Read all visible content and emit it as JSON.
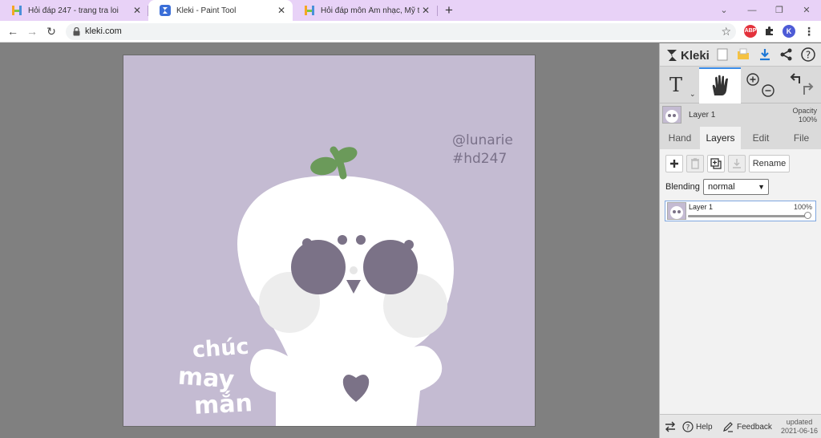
{
  "browser": {
    "tabs": [
      {
        "title": "Hỏi đáp 247 - trang tra loi",
        "favicon": "hoidap-h-icon",
        "active": false
      },
      {
        "title": "Kleki - Paint Tool",
        "favicon": "kleki-icon",
        "active": true
      },
      {
        "title": "Hỏi đáp môn Âm nhạc, Mỹ thuật",
        "favicon": "hoidap-h-icon",
        "active": false
      }
    ],
    "new_tab_label": "+",
    "close_label": "✕",
    "url": "kleki.com",
    "extensions": [
      {
        "name": "abp-icon",
        "label": "ABP",
        "color": "#e3323c"
      },
      {
        "name": "puzzle-icon",
        "label": "",
        "color": "#333333"
      },
      {
        "name": "profile-avatar",
        "label": "K",
        "color": "#4d5bd6"
      }
    ],
    "colors": {
      "tab_strip": "#e8d2f7",
      "active_tab": "#ffffff"
    }
  },
  "canvas": {
    "background": "#c4bbd2",
    "watermark_line1": "@lunarie",
    "watermark_line2": "#hd247",
    "text_line1": "chúc",
    "text_line2": "may",
    "text_line3": "mắn",
    "colors": {
      "body": "#ffffff",
      "eyes": "#7b7287",
      "sprout": "#6b9a5a",
      "cheeks": "#ededed"
    }
  },
  "panel": {
    "app_name": "Kleki",
    "top_icons": [
      "new-file-icon",
      "open-folder-icon",
      "download-icon",
      "share-icon",
      "help-icon"
    ],
    "tools": {
      "text_glyph": "T",
      "active_tool": "hand-tool",
      "zoom": [
        "zoom-in-icon",
        "zoom-out-icon"
      ],
      "history": [
        "undo-icon",
        "redo-icon"
      ]
    },
    "layer_preview": {
      "name": "Layer 1",
      "opacity_label": "Opacity",
      "opacity_value": "100%"
    },
    "tabs": [
      {
        "label": "Hand",
        "active": false
      },
      {
        "label": "Layers",
        "active": true
      },
      {
        "label": "Edit",
        "active": false
      },
      {
        "label": "File",
        "active": false
      }
    ],
    "layers": {
      "rename_label": "Rename",
      "blending_label": "Blending",
      "blending_value": "normal",
      "items": [
        {
          "name": "Layer 1",
          "opacity": "100%",
          "opacity_level": 1.0
        }
      ]
    },
    "bottom": {
      "help_label": "Help",
      "feedback_label": "Feedback",
      "updated_label": "updated",
      "updated_date": "2021-06-16"
    }
  }
}
